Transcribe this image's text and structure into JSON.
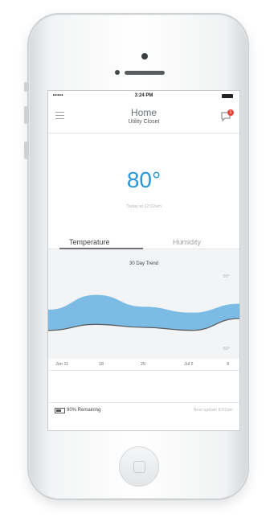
{
  "status": {
    "signal": "•••••",
    "time": "3:24 PM"
  },
  "header": {
    "title": "Home",
    "subtitle": "Utility Closet",
    "notification_count": "1"
  },
  "current": {
    "temperature": "80°",
    "updated": "Today at 12:02am"
  },
  "tabs": [
    {
      "label": "Temperature",
      "active": true
    },
    {
      "label": "Humidity",
      "active": false
    }
  ],
  "chart": {
    "title": "30 Day Trend",
    "y_high_label": "90°",
    "y_low_label": "60°",
    "x_labels": [
      "Jun 11",
      "18",
      "25",
      "Jul 2",
      "9"
    ]
  },
  "chart_data": {
    "type": "area",
    "title": "30 Day Trend",
    "x": [
      "Jun 11",
      "18",
      "25",
      "Jul 2",
      "9"
    ],
    "ylim": [
      60,
      90
    ],
    "series": [
      {
        "values": [
          75,
          80,
          76,
          74,
          77
        ]
      },
      {
        "values": [
          68,
          70,
          69,
          68,
          72
        ]
      }
    ],
    "colors": {
      "fill": "#6fb5e2",
      "line": "#5a5e62"
    }
  },
  "footer": {
    "battery": "90% Remaining",
    "next_update": "Next update 8:02am"
  },
  "colors": {
    "accent": "#2a96d8",
    "badge": "#e2483b"
  }
}
